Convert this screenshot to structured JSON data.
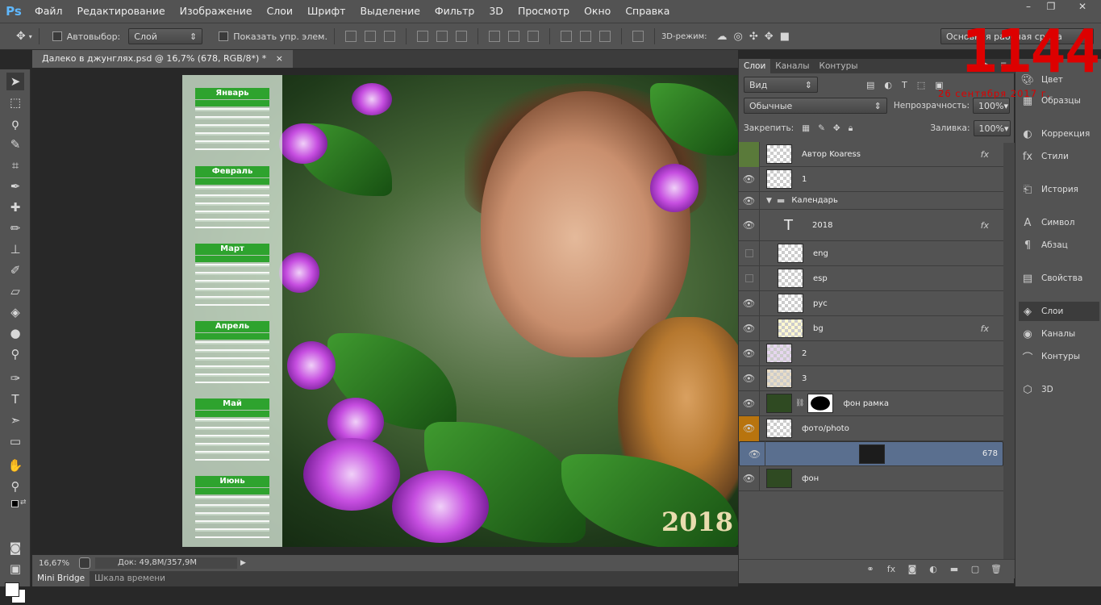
{
  "app": {
    "logo": "Ps"
  },
  "menu": [
    "Файл",
    "Редактирование",
    "Изображение",
    "Слои",
    "Шрифт",
    "Выделение",
    "Фильтр",
    "3D",
    "Просмотр",
    "Окно",
    "Справка"
  ],
  "options": {
    "autoselect_label": "Автовыбор:",
    "autoselect_value": "Слой",
    "show_controls_label": "Показать упр. элем.",
    "mode3d_label": "3D-режим:",
    "workspace": "Основная рабочая среда"
  },
  "document": {
    "tab_title": "Далеко в джунглях.psd @ 16,7% (678, RGB/8*) *"
  },
  "calendar": {
    "months": [
      "Январь",
      "Февраль",
      "Март",
      "Апрель",
      "Май",
      "Июнь"
    ],
    "year": "2018"
  },
  "status": {
    "zoom": "16,67%",
    "doc": "Док: 49,8M/357,9M"
  },
  "bottom_tabs": [
    "Mini Bridge",
    "Шкала времени"
  ],
  "layers_panel": {
    "tabs": [
      "Слои",
      "Каналы",
      "Контуры"
    ],
    "filter": "Вид",
    "blend_mode": "Обычные",
    "opacity_label": "Непрозрачность:",
    "opacity_value": "100%",
    "lock_label": "Закрепить:",
    "fill_label": "Заливка:",
    "fill_value": "100%",
    "layers": [
      {
        "name": "Автор Koaress",
        "fx": "fx"
      },
      {
        "name": "1"
      },
      {
        "name": "Календарь"
      },
      {
        "name": "2018",
        "fx": "fx"
      },
      {
        "name": "eng"
      },
      {
        "name": "esp"
      },
      {
        "name": "рус"
      },
      {
        "name": "bg",
        "fx": "fx"
      },
      {
        "name": "2"
      },
      {
        "name": "3"
      },
      {
        "name": "фон рамка"
      },
      {
        "name": "фото/photo"
      },
      {
        "name": "678"
      },
      {
        "name": "фон"
      }
    ]
  },
  "dock": [
    "Цвет",
    "Образцы",
    "Коррекция",
    "Стили",
    "История",
    "Символ",
    "Абзац",
    "Свойства",
    "Слои",
    "Каналы",
    "Контуры",
    "3D"
  ],
  "clock": {
    "time": "1144",
    "date": "26 сентября 2017 г."
  }
}
